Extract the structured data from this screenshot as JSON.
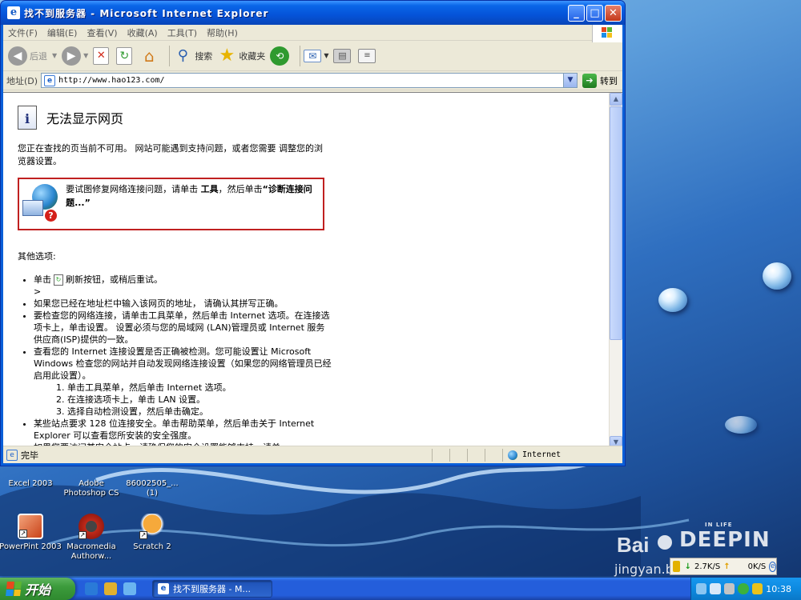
{
  "window": {
    "title": "找不到服务器 - Microsoft Internet Explorer"
  },
  "menu": [
    "文件(F)",
    "编辑(E)",
    "查看(V)",
    "收藏(A)",
    "工具(T)",
    "帮助(H)"
  ],
  "toolbar": {
    "back_label": "后退",
    "search_label": "搜索",
    "favorites_label": "收藏夹"
  },
  "address": {
    "label": "地址(D)",
    "url": "http://www.hao123.com/",
    "go_label": "转到"
  },
  "page": {
    "error_title": "无法显示网页",
    "intro": "您正在查找的页当前不可用。 网站可能遇到支持问题，或者您需要 调整您的浏览器设置。",
    "tip_prefix": "要试图修复网络连接问题，请单击 ",
    "tip_tools": "工具",
    "tip_mid": "，然后单击",
    "tip_diag": "“诊断连接问题...”",
    "other_options": "其他选项:",
    "bullet1_a": "单击",
    "bullet1_b": "刷新按钮，或稍后重试。",
    "bullet1_gt": ">",
    "bullet2": "如果您已经在地址栏中输入该网页的地址， 请确认其拼写正确。",
    "bullet3": "要检查您的网络连接，请单击工具菜单，然后单击 Internet 选项。在连接选项卡上，单击设置。 设置必须与您的局域网 (LAN)管理员或 Internet 服务供应商(ISP)提供的一致。",
    "bullet4": "查看您的 Internet 连接设置是否正确被检测。您可能设置让 Microsoft Windows 检查您的网站并自动发现网络连接设置（如果您的网络管理员已经启用此设置）。",
    "sub1": "单击工具菜单，然后单击 Internet 选项。",
    "sub2": "在连接选项卡上，单击 LAN 设置。",
    "sub3": "选择自动检测设置，然后单击确定。",
    "bullet5": "某些站点要求 128 位连接安全。单击帮助菜单，然后单击关于 Internet Explorer 可以查看您所安装的安全强度。",
    "bullet6": "如果您要访问某安全站点，请确保您的安全设置能够支持。请单"
  },
  "status": {
    "text": "完毕",
    "zone": "Internet"
  },
  "desktop": {
    "icons": [
      {
        "label": "Excel 2003"
      },
      {
        "label": "Adobe Photoshop CS"
      },
      {
        "label": "86002505_... (1)"
      },
      {
        "label": "PowerPint 2003"
      },
      {
        "label": "Macromedia Authorw..."
      },
      {
        "label": "Scratch 2"
      }
    ],
    "watermark_top": "DEEPIN",
    "watermark_small": "IN LIFE",
    "watermark_bottom": "jingyan.baidu.com"
  },
  "netmon": {
    "down": "2.7K/S",
    "up": "0K/S"
  },
  "taskbar": {
    "start_label": "开始",
    "task_label": "找不到服务器 - M...",
    "clock": "10:38"
  },
  "colors": {
    "titlebar": "#0553d8",
    "tip_border": "#c02020",
    "start": "#3c9b3c"
  }
}
